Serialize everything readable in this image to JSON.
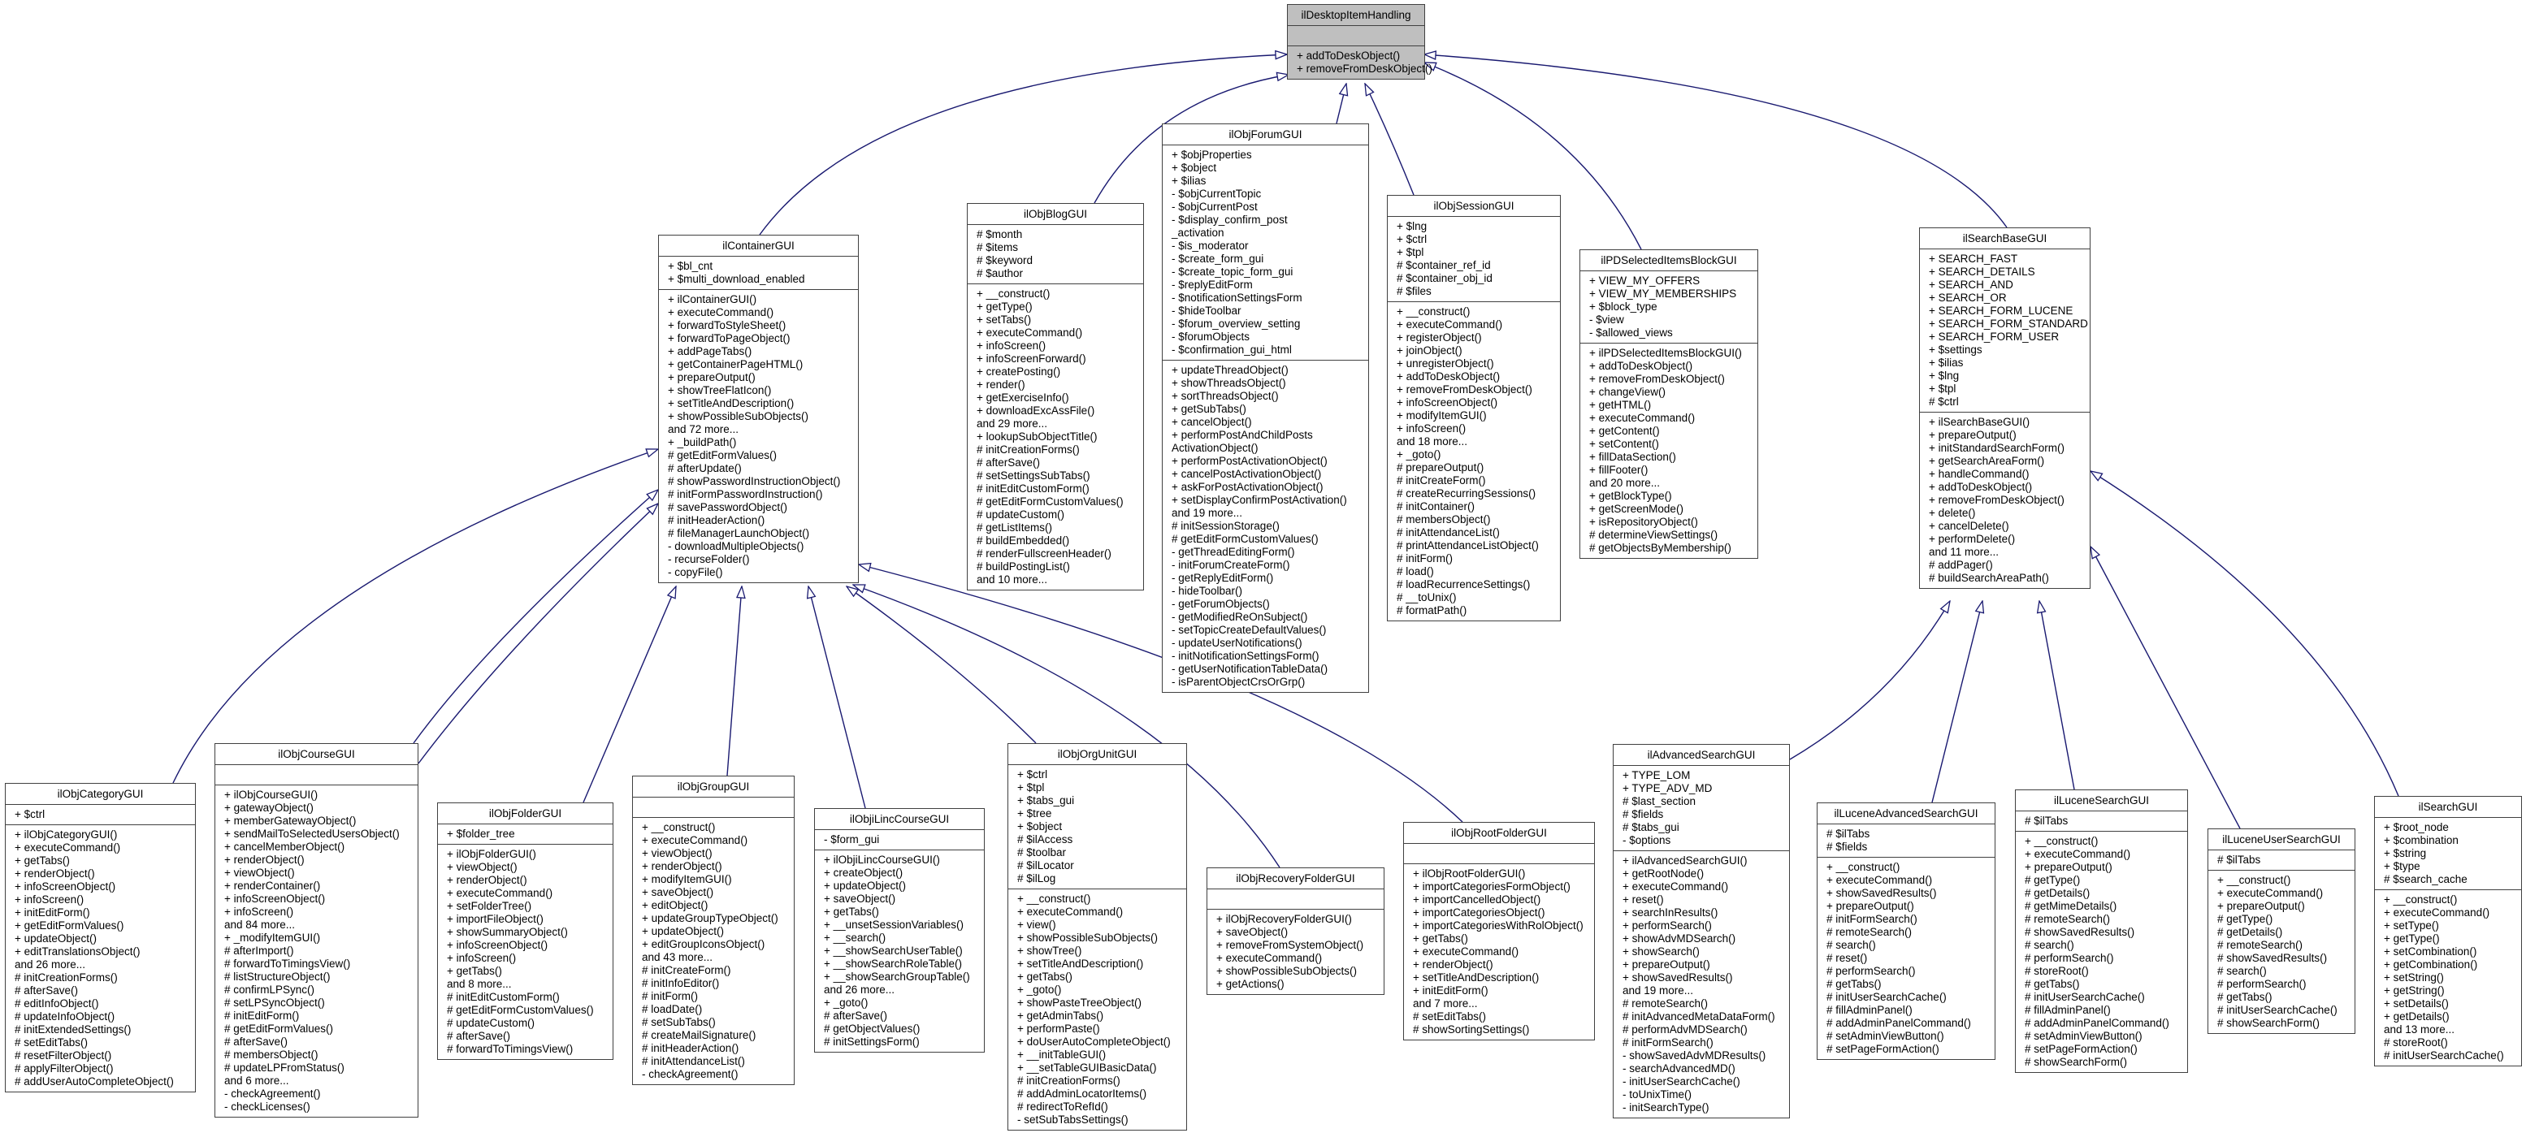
{
  "colors": {
    "edge": "#191970",
    "border": "#404040",
    "base_fill": "#bfbfbf",
    "class_fill": "#ffffff"
  },
  "classes": [
    {
      "name": "ilDesktopItemHandling",
      "highlight": true,
      "attributes": [],
      "methods": [
        "+ addToDeskObject()",
        "+ removeFromDeskObject()"
      ]
    },
    {
      "name": "ilContainerGUI",
      "attributes": [
        "+ $bl_cnt",
        "+ $multi_download_enabled"
      ],
      "methods": [
        "+ ilContainerGUI()",
        "+ executeCommand()",
        "+ forwardToStyleSheet()",
        "+ forwardToPageObject()",
        "+ addPageTabs()",
        "+ getContainerPageHTML()",
        "+ prepareOutput()",
        "+ showTreeFlatIcon()",
        "+ setTitleAndDescription()",
        "+ showPossibleSubObjects()",
        "and 72 more...",
        "+ _buildPath()",
        "# getEditFormValues()",
        "# afterUpdate()",
        "# showPasswordInstructionObject()",
        "# initFormPasswordInstruction()",
        "# savePasswordObject()",
        "# initHeaderAction()",
        "# fileManagerLaunchObject()",
        "- downloadMultipleObjects()",
        "- recurseFolder()",
        "- copyFile()"
      ]
    },
    {
      "name": "ilObjBlogGUI",
      "attributes": [
        "# $month",
        "# $items",
        "# $keyword",
        "# $author"
      ],
      "methods": [
        "+ __construct()",
        "+ getType()",
        "+ setTabs()",
        "+ executeCommand()",
        "+ infoScreen()",
        "+ infoScreenForward()",
        "+ createPosting()",
        "+ render()",
        "+ getExerciseInfo()",
        "+ downloadExcAssFile()",
        "and 29 more...",
        "+ lookupSubObjectTitle()",
        "# initCreationForms()",
        "# afterSave()",
        "# setSettingsSubTabs()",
        "# initEditCustomForm()",
        "# getEditFormCustomValues()",
        "# updateCustom()",
        "# getListItems()",
        "# buildEmbedded()",
        "# renderFullscreenHeader()",
        "# buildPostingList()",
        "and 10 more..."
      ]
    },
    {
      "name": "ilObjForumGUI",
      "attributes": [
        "+ $objProperties",
        "+ $object",
        "+ $ilias",
        "- $objCurrentTopic",
        "- $objCurrentPost",
        "- $display_confirm_post",
        "_activation",
        "- $is_moderator",
        "- $create_form_gui",
        "- $create_topic_form_gui",
        "- $replyEditForm",
        "- $notificationSettingsForm",
        "- $hideToolbar",
        "- $forum_overview_setting",
        "- $forumObjects",
        "- $confirmation_gui_html"
      ],
      "methods": [
        "+ updateThreadObject()",
        "+ showThreadsObject()",
        "+ sortThreadsObject()",
        "+ getSubTabs()",
        "+ cancelObject()",
        "+ performPostAndChildPosts",
        "ActivationObject()",
        "+ performPostActivationObject()",
        "+ cancelPostActivationObject()",
        "+ askForPostActivationObject()",
        "+ setDisplayConfirmPostActivation()",
        "and 19 more...",
        "# initSessionStorage()",
        "# getEditFormCustomValues()",
        "- getThreadEditingForm()",
        "- initForumCreateForm()",
        "- getReplyEditForm()",
        "- hideToolbar()",
        "- getForumObjects()",
        "- getModifiedReOnSubject()",
        "- setTopicCreateDefaultValues()",
        "- updateUserNotifications()",
        "- initNotificationSettingsForm()",
        "- getUserNotificationTableData()",
        "- isParentObjectCrsOrGrp()"
      ]
    },
    {
      "name": "ilObjSessionGUI",
      "attributes": [
        "+ $lng",
        "+ $ctrl",
        "+ $tpl",
        "# $container_ref_id",
        "# $container_obj_id",
        "# $files"
      ],
      "methods": [
        "+ __construct()",
        "+ executeCommand()",
        "+ registerObject()",
        "+ joinObject()",
        "+ unregisterObject()",
        "+ addToDeskObject()",
        "+ removeFromDeskObject()",
        "+ infoScreenObject()",
        "+ modifyItemGUI()",
        "+ infoScreen()",
        "and 18 more...",
        "+ _goto()",
        "# prepareOutput()",
        "# initCreateForm()",
        "# createRecurringSessions()",
        "# initContainer()",
        "# membersObject()",
        "# initAttendanceList()",
        "# printAttendanceListObject()",
        "# initForm()",
        "# load()",
        "# loadRecurrenceSettings()",
        "# __toUnix()",
        "# formatPath()"
      ]
    },
    {
      "name": "ilPDSelectedItemsBlockGUI",
      "attributes": [
        "+ VIEW_MY_OFFERS",
        "+ VIEW_MY_MEMBERSHIPS",
        "+ $block_type",
        "- $view",
        "- $allowed_views"
      ],
      "methods": [
        "+ ilPDSelectedItemsBlockGUI()",
        "+ addToDeskObject()",
        "+ removeFromDeskObject()",
        "+ changeView()",
        "+ getHTML()",
        "+ executeCommand()",
        "+ getContent()",
        "+ setContent()",
        "+ fillDataSection()",
        "+ fillFooter()",
        "and 20 more...",
        "+ getBlockType()",
        "+ getScreenMode()",
        "+ isRepositoryObject()",
        "# determineViewSettings()",
        "# getObjectsByMembership()"
      ]
    },
    {
      "name": "ilSearchBaseGUI",
      "attributes": [
        "+ SEARCH_FAST",
        "+ SEARCH_DETAILS",
        "+ SEARCH_AND",
        "+ SEARCH_OR",
        "+ SEARCH_FORM_LUCENE",
        "+ SEARCH_FORM_STANDARD",
        "+ SEARCH_FORM_USER",
        "+ $settings",
        "+ $ilias",
        "+ $lng",
        "+ $tpl",
        "# $ctrl"
      ],
      "methods": [
        "+ ilSearchBaseGUI()",
        "+ prepareOutput()",
        "+ initStandardSearchForm()",
        "+ getSearchAreaForm()",
        "+ handleCommand()",
        "+ addToDeskObject()",
        "+ removeFromDeskObject()",
        "+ delete()",
        "+ cancelDelete()",
        "+ performDelete()",
        "and 11 more...",
        "# addPager()",
        "# buildSearchAreaPath()"
      ]
    },
    {
      "name": "ilObjCategoryGUI",
      "attributes": [
        "+ $ctrl"
      ],
      "methods": [
        "+ ilObjCategoryGUI()",
        "+ executeCommand()",
        "+ getTabs()",
        "+ renderObject()",
        "+ infoScreenObject()",
        "+ infoScreen()",
        "+ initEditForm()",
        "+ getEditFormValues()",
        "+ updateObject()",
        "+ editTranslationsObject()",
        "and 26 more...",
        "# initCreationForms()",
        "# afterSave()",
        "# editInfoObject()",
        "# updateInfoObject()",
        "# initExtendedSettings()",
        "# setEditTabs()",
        "# resetFilterObject()",
        "# applyFilterObject()",
        "# addUserAutoCompleteObject()"
      ]
    },
    {
      "name": "ilObjCourseGUI",
      "attributes": [],
      "methods": [
        "+ ilObjCourseGUI()",
        "+ gatewayObject()",
        "+ memberGatewayObject()",
        "+ sendMailToSelectedUsersObject()",
        "+ cancelMemberObject()",
        "+ renderObject()",
        "+ viewObject()",
        "+ renderContainer()",
        "+ infoScreenObject()",
        "+ infoScreen()",
        "and 84 more...",
        "+ _modifyItemGUI()",
        "# afterImport()",
        "# forwardToTimingsView()",
        "# listStructureObject()",
        "# confirmLPSync()",
        "# setLPSyncObject()",
        "# initEditForm()",
        "# getEditFormValues()",
        "# afterSave()",
        "# membersObject()",
        "# updateLPFromStatus()",
        "and 6 more...",
        "- checkAgreement()",
        "- checkLicenses()"
      ]
    },
    {
      "name": "ilObjFolderGUI",
      "attributes": [
        "+ $folder_tree"
      ],
      "methods": [
        "+ ilObjFolderGUI()",
        "+ viewObject()",
        "+ renderObject()",
        "+ executeCommand()",
        "+ setFolderTree()",
        "+ importFileObject()",
        "+ showSummaryObject()",
        "+ infoScreenObject()",
        "+ infoScreen()",
        "+ getTabs()",
        "and 8 more...",
        "# initEditCustomForm()",
        "# getEditFormCustomValues()",
        "# updateCustom()",
        "# afterSave()",
        "# forwardToTimingsView()"
      ]
    },
    {
      "name": "ilObjGroupGUI",
      "attributes": [],
      "methods": [
        "+ __construct()",
        "+ executeCommand()",
        "+ viewObject()",
        "+ renderObject()",
        "+ modifyItemGUI()",
        "+ saveObject()",
        "+ editObject()",
        "+ updateGroupTypeObject()",
        "+ updateObject()",
        "+ editGroupIconsObject()",
        "and 43 more...",
        "# initCreateForm()",
        "# initInfoEditor()",
        "# initForm()",
        "# loadDate()",
        "# setSubTabs()",
        "# createMailSignature()",
        "# initHeaderAction()",
        "# initAttendanceList()",
        "- checkAgreement()"
      ]
    },
    {
      "name": "ilObjiLincCourseGUI",
      "attributes": [
        "- $form_gui"
      ],
      "methods": [
        "+ ilObjiLincCourseGUI()",
        "+ createObject()",
        "+ updateObject()",
        "+ saveObject()",
        "+ getTabs()",
        "+ __unsetSessionVariables()",
        "+ __search()",
        "+ __showSearchUserTable()",
        "+ __showSearchRoleTable()",
        "+ __showSearchGroupTable()",
        "and 26 more...",
        "+ _goto()",
        "# afterSave()",
        "# getObjectValues()",
        "# initSettingsForm()"
      ]
    },
    {
      "name": "ilObjOrgUnitGUI",
      "attributes": [
        "+ $ctrl",
        "+ $tpl",
        "+ $tabs_gui",
        "+ $tree",
        "+ $object",
        "# $ilAccess",
        "# $toolbar",
        "# $ilLocator",
        "# $ilLog"
      ],
      "methods": [
        "+ __construct()",
        "+ executeCommand()",
        "+ view()",
        "+ showPossibleSubObjects()",
        "+ showTree()",
        "+ setTitleAndDescription()",
        "+ getTabs()",
        "+ _goto()",
        "+ showPasteTreeObject()",
        "+ getAdminTabs()",
        "+ performPaste()",
        "+ doUserAutoCompleteObject()",
        "+ __initTableGUI()",
        "+ __setTableGUIBasicData()",
        "# initCreationForms()",
        "# addAdminLocatorItems()",
        "# redirectToRefId()",
        "- setSubTabsSettings()"
      ]
    },
    {
      "name": "ilObjRecoveryFolderGUI",
      "attributes": [],
      "methods": [
        "+ ilObjRecoveryFolderGUI()",
        "+ saveObject()",
        "+ removeFromSystemObject()",
        "+ executeCommand()",
        "+ showPossibleSubObjects()",
        "+ getActions()"
      ]
    },
    {
      "name": "ilObjRootFolderGUI",
      "attributes": [],
      "methods": [
        "+ ilObjRootFolderGUI()",
        "+ importCategoriesFormObject()",
        "+ importCancelledObject()",
        "+ importCategoriesObject()",
        "+ importCategoriesWithRolObject()",
        "+ getTabs()",
        "+ executeCommand()",
        "+ renderObject()",
        "+ setTitleAndDescription()",
        "+ initEditForm()",
        "and 7 more...",
        "# setEditTabs()",
        "# showSortingSettings()"
      ]
    },
    {
      "name": "ilAdvancedSearchGUI",
      "attributes": [
        "+ TYPE_LOM",
        "+ TYPE_ADV_MD",
        "# $last_section",
        "# $fields",
        "# $tabs_gui",
        "- $options"
      ],
      "methods": [
        "+ ilAdvancedSearchGUI()",
        "+ getRootNode()",
        "+ executeCommand()",
        "+ reset()",
        "+ searchInResults()",
        "+ performSearch()",
        "+ showAdvMDSearch()",
        "+ showSearch()",
        "+ prepareOutput()",
        "+ showSavedResults()",
        "and 19 more...",
        "# remoteSearch()",
        "# initAdvancedMetaDataForm()",
        "# performAdvMDSearch()",
        "# initFormSearch()",
        "- showSavedAdvMDResults()",
        "- searchAdvancedMD()",
        "- initUserSearchCache()",
        "- toUnixTime()",
        "- initSearchType()"
      ]
    },
    {
      "name": "ilLuceneAdvancedSearchGUI",
      "attributes": [
        "# $ilTabs",
        "# $fields"
      ],
      "methods": [
        "+ __construct()",
        "+ executeCommand()",
        "+ showSavedResults()",
        "+ prepareOutput()",
        "# initFormSearch()",
        "# remoteSearch()",
        "# search()",
        "# reset()",
        "# performSearch()",
        "# getTabs()",
        "# initUserSearchCache()",
        "# fillAdminPanel()",
        "# addAdminPanelCommand()",
        "# setAdminViewButton()",
        "# setPageFormAction()"
      ]
    },
    {
      "name": "ilLuceneSearchGUI",
      "attributes": [
        "# $ilTabs"
      ],
      "methods": [
        "+ __construct()",
        "+ executeCommand()",
        "+ prepareOutput()",
        "# getType()",
        "# getDetails()",
        "# getMimeDetails()",
        "# remoteSearch()",
        "# showSavedResults()",
        "# search()",
        "# performSearch()",
        "# storeRoot()",
        "# getTabs()",
        "# initUserSearchCache()",
        "# fillAdminPanel()",
        "# addAdminPanelCommand()",
        "# setAdminViewButton()",
        "# setPageFormAction()",
        "# showSearchForm()"
      ]
    },
    {
      "name": "ilLuceneUserSearchGUI",
      "attributes": [
        "# $ilTabs"
      ],
      "methods": [
        "+ __construct()",
        "+ executeCommand()",
        "+ prepareOutput()",
        "# getType()",
        "# getDetails()",
        "# remoteSearch()",
        "# showSavedResults()",
        "# search()",
        "# performSearch()",
        "# getTabs()",
        "# initUserSearchCache()",
        "# showSearchForm()"
      ]
    },
    {
      "name": "ilSearchGUI",
      "attributes": [
        "+ $root_node",
        "+ $combination",
        "+ $string",
        "+ $type",
        "# $search_cache"
      ],
      "methods": [
        "+ __construct()",
        "+ executeCommand()",
        "+ setType()",
        "+ getType()",
        "+ setCombination()",
        "+ getCombination()",
        "+ setString()",
        "+ getString()",
        "+ setDetails()",
        "+ getDetails()",
        "and 13 more...",
        "# storeRoot()",
        "# initUserSearchCache()"
      ]
    }
  ],
  "inheritance": [
    {
      "child": "ilContainerGUI",
      "parent": "ilDesktopItemHandling"
    },
    {
      "child": "ilObjBlogGUI",
      "parent": "ilDesktopItemHandling"
    },
    {
      "child": "ilObjForumGUI",
      "parent": "ilDesktopItemHandling"
    },
    {
      "child": "ilObjSessionGUI",
      "parent": "ilDesktopItemHandling"
    },
    {
      "child": "ilPDSelectedItemsBlockGUI",
      "parent": "ilDesktopItemHandling"
    },
    {
      "child": "ilSearchBaseGUI",
      "parent": "ilDesktopItemHandling"
    },
    {
      "child": "ilObjCategoryGUI",
      "parent": "ilContainerGUI"
    },
    {
      "child": "ilObjCourseGUI",
      "parent": "ilContainerGUI"
    },
    {
      "child": "ilObjCourseGUI",
      "parent": "ilContainerGUI"
    },
    {
      "child": "ilObjFolderGUI",
      "parent": "ilContainerGUI"
    },
    {
      "child": "ilObjGroupGUI",
      "parent": "ilContainerGUI"
    },
    {
      "child": "ilObjiLincCourseGUI",
      "parent": "ilContainerGUI"
    },
    {
      "child": "ilObjOrgUnitGUI",
      "parent": "ilContainerGUI"
    },
    {
      "child": "ilObjRecoveryFolderGUI",
      "parent": "ilContainerGUI"
    },
    {
      "child": "ilObjRootFolderGUI",
      "parent": "ilContainerGUI"
    },
    {
      "child": "ilAdvancedSearchGUI",
      "parent": "ilSearchBaseGUI"
    },
    {
      "child": "ilLuceneAdvancedSearchGUI",
      "parent": "ilSearchBaseGUI"
    },
    {
      "child": "ilLuceneSearchGUI",
      "parent": "ilSearchBaseGUI"
    },
    {
      "child": "ilLuceneUserSearchGUI",
      "parent": "ilSearchBaseGUI"
    },
    {
      "child": "ilSearchGUI",
      "parent": "ilSearchBaseGUI"
    }
  ]
}
